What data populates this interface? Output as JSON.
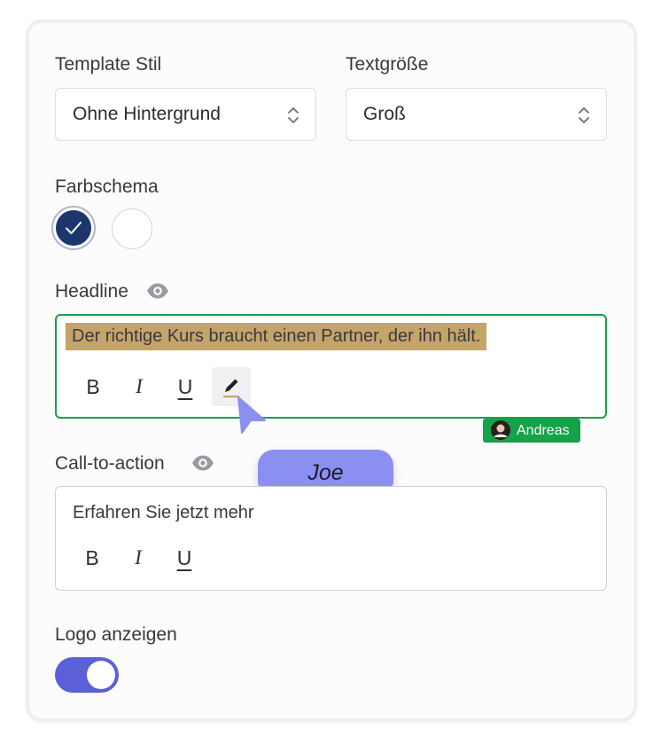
{
  "template_style": {
    "label": "Template Stil",
    "value": "Ohne Hintergrund",
    "arrows_icon": "chevron-updown-icon"
  },
  "text_size": {
    "label": "Textgröße",
    "value": "Groß",
    "arrows_icon": "chevron-updown-icon"
  },
  "color_scheme": {
    "label": "Farbschema",
    "swatches": [
      {
        "name": "navy",
        "color": "#1c356a",
        "selected": true
      },
      {
        "name": "white",
        "color": "#ffffff",
        "selected": false
      }
    ]
  },
  "headline": {
    "label": "Headline",
    "visibility_icon": "eye-icon",
    "text": "Der richtige Kurs braucht einen Partner, der ihn hält.",
    "highlight_color": "#c4a46a",
    "border_color": "#19a24a",
    "toolbar": {
      "bold": "B",
      "italic": "I",
      "underline": "U",
      "edit_icon": "pencil-icon"
    },
    "collaborator": {
      "name": "Andreas",
      "color": "#15a24a"
    }
  },
  "remote_cursor": {
    "name": "Joe",
    "color": "#8b8ff0"
  },
  "cta": {
    "label": "Call-to-action",
    "visibility_icon": "eye-icon",
    "text": "Erfahren Sie jetzt mehr",
    "toolbar": {
      "bold": "B",
      "italic": "I",
      "underline": "U"
    }
  },
  "logo": {
    "label": "Logo anzeigen",
    "enabled": true,
    "accent": "#5b5fd8"
  }
}
